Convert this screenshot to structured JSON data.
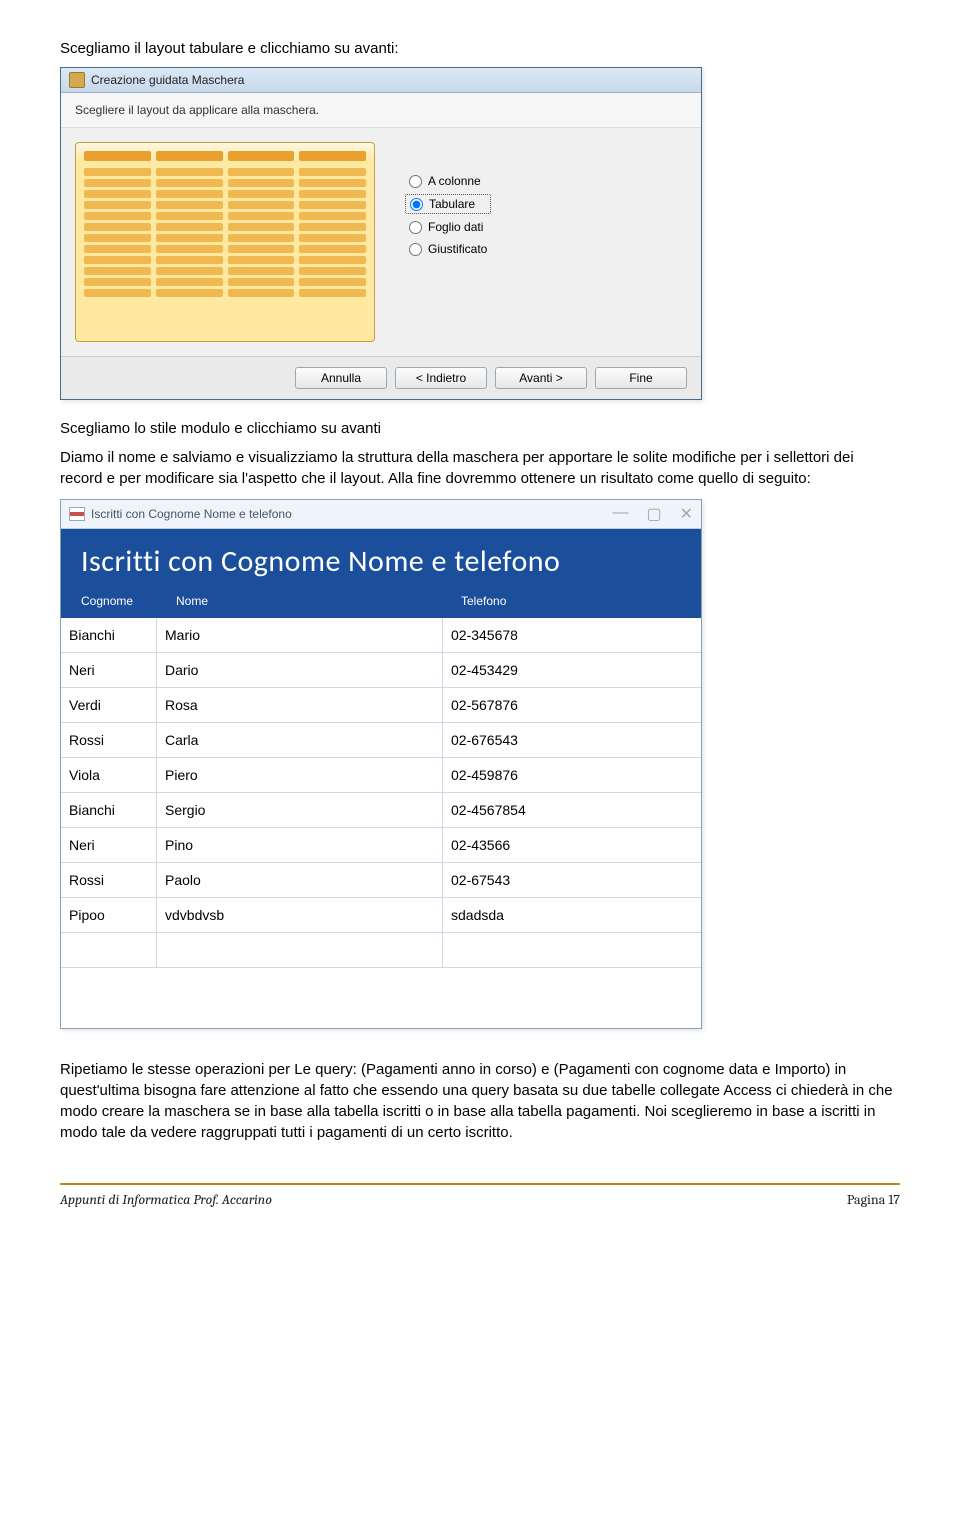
{
  "intro_text_1": "Scegliamo il layout tabulare e clicchiamo su avanti:",
  "wizard": {
    "title": "Creazione guidata Maschera",
    "instruction": "Scegliere il layout da applicare alla maschera.",
    "options": {
      "col": "A colonne",
      "tab": "Tabulare",
      "foglio": "Foglio dati",
      "giust": "Giustificato"
    },
    "buttons": {
      "annulla": "Annulla",
      "indietro": "< Indietro",
      "avanti": "Avanti >",
      "fine": "Fine"
    }
  },
  "mid_text_1": "Scegliamo lo stile modulo e clicchiamo su avanti",
  "mid_text_2": "Diamo il nome e salviamo e visualizziamo la struttura della maschera per apportare le solite modifiche per i sellettori dei record e per modificare sia l'aspetto che il layout. Alla fine dovremmo ottenere un risultato come quello di seguito:",
  "form": {
    "tab_label": "Iscritti con Cognome Nome e telefono",
    "title": "Iscritti con Cognome Nome e telefono",
    "headers": {
      "cognome": "Cognome",
      "nome": "Nome",
      "telefono": "Telefono"
    },
    "rows": [
      {
        "cognome": "Bianchi",
        "nome": "Mario",
        "telefono": "02-345678"
      },
      {
        "cognome": "Neri",
        "nome": "Dario",
        "telefono": "02-453429"
      },
      {
        "cognome": "Verdi",
        "nome": "Rosa",
        "telefono": "02-567876"
      },
      {
        "cognome": "Rossi",
        "nome": "Carla",
        "telefono": "02-676543"
      },
      {
        "cognome": "Viola",
        "nome": "Piero",
        "telefono": "02-459876"
      },
      {
        "cognome": "Bianchi",
        "nome": "Sergio",
        "telefono": "02-4567854"
      },
      {
        "cognome": "Neri",
        "nome": "Pino",
        "telefono": "02-43566"
      },
      {
        "cognome": "Rossi",
        "nome": "Paolo",
        "telefono": "02-67543"
      },
      {
        "cognome": "Pipoo",
        "nome": "vdvbdvsb",
        "telefono": "sdadsda"
      }
    ]
  },
  "final_text": "Ripetiamo le stesse operazioni per Le query: (Pagamenti anno in corso) e (Pagamenti con cognome data e Importo) in quest'ultima bisogna fare attenzione al fatto che essendo una query basata su due tabelle collegate Access ci chiederà in che modo creare la maschera se in base alla tabella iscritti o in base alla tabella pagamenti. Noi sceglieremo in base a iscritti in modo tale da vedere raggruppati tutti i pagamenti di un certo iscritto.",
  "footer": {
    "left": "Appunti di Informatica Prof. Accarino",
    "right": "Pagina 17"
  }
}
